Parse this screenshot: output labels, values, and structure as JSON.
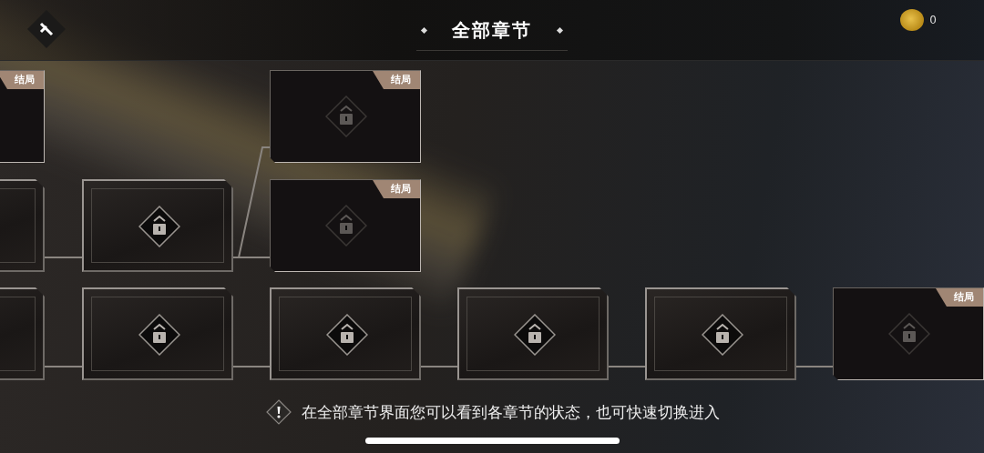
{
  "header": {
    "title": "全部章节",
    "coins": "0"
  },
  "nodes": [
    {
      "kind": "ending",
      "badge": "结局"
    },
    {
      "kind": "ending",
      "badge": "结局"
    },
    {
      "kind": "chapter"
    },
    {
      "kind": "chapter"
    },
    {
      "kind": "ending",
      "badge": "结局"
    },
    {
      "kind": "chapter"
    },
    {
      "kind": "chapter"
    },
    {
      "kind": "chapter"
    },
    {
      "kind": "chapter"
    },
    {
      "kind": "chapter"
    },
    {
      "kind": "ending",
      "badge": "结局"
    }
  ],
  "hint": {
    "text": "在全部章节界面您可以看到各章节的状态，也可快速切换进入"
  }
}
